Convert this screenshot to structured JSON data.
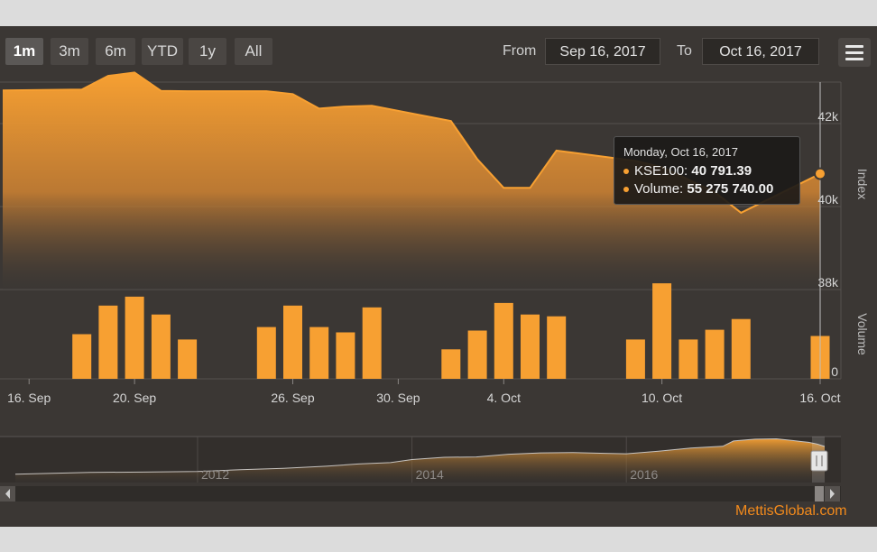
{
  "range_selector": {
    "buttons": [
      "1m",
      "3m",
      "6m",
      "YTD",
      "1y",
      "All"
    ],
    "selected": "1m"
  },
  "date_inputs": {
    "from_label": "From",
    "from_value": "Sep 16, 2017",
    "to_label": "To",
    "to_value": "Oct 16, 2017"
  },
  "menu_icon": "hamburger-menu-icon",
  "tooltip": {
    "header": "Monday, Oct 16, 2017",
    "line1_label": "KSE100:",
    "line1_value": "40 791.39",
    "line2_label": "Volume:",
    "line2_value": "55 275 740.00"
  },
  "credit": "MettisGlobal.com",
  "colors": {
    "accent": "#f7a032",
    "background": "#3b3734",
    "credit": "#f28a1c"
  },
  "chart_data": {
    "type": "area",
    "panels": [
      {
        "name": "price",
        "series_type": "area",
        "axis_title": "Index",
        "ylim": [
          38000,
          43000
        ],
        "yticks": [
          38000,
          40000,
          42000
        ],
        "ytick_labels": [
          "38k",
          "40k",
          "42k"
        ],
        "x": [
          "2017-09-15",
          "2017-09-18",
          "2017-09-19",
          "2017-09-20",
          "2017-09-21",
          "2017-09-22",
          "2017-09-25",
          "2017-09-26",
          "2017-09-27",
          "2017-09-28",
          "2017-09-29",
          "2017-10-02",
          "2017-10-03",
          "2017-10-04",
          "2017-10-05",
          "2017-10-06",
          "2017-10-09",
          "2017-10-10",
          "2017-10-11",
          "2017-10-12",
          "2017-10-13",
          "2017-10-16"
        ],
        "values": [
          42800,
          42820,
          43150,
          43230,
          42790,
          42780,
          42780,
          42710,
          42360,
          42410,
          42430,
          42060,
          41140,
          40450,
          40450,
          41350,
          41100,
          40950,
          40650,
          40350,
          39850,
          40791.39
        ]
      },
      {
        "name": "volume",
        "series_type": "column",
        "axis_title": "Volume",
        "ylim": [
          0,
          100000000
        ],
        "yticks": [
          0
        ],
        "ytick_labels": [
          "0"
        ],
        "x": [
          "2017-09-18",
          "2017-09-19",
          "2017-09-20",
          "2017-09-21",
          "2017-09-22",
          "2017-09-25",
          "2017-09-26",
          "2017-09-27",
          "2017-09-28",
          "2017-09-29",
          "2017-10-02",
          "2017-10-03",
          "2017-10-04",
          "2017-10-05",
          "2017-10-06",
          "2017-10-09",
          "2017-10-10",
          "2017-10-11",
          "2017-10-12",
          "2017-10-13",
          "2017-10-16"
        ],
        "values": [
          50000000,
          82000000,
          92000000,
          72000000,
          44000000,
          58000000,
          82000000,
          58000000,
          52000000,
          80000000,
          33000000,
          54000000,
          85000000,
          72000000,
          70000000,
          44000000,
          107000000,
          44000000,
          55000000,
          67000000,
          48000000
        ]
      }
    ],
    "xticks": [
      "2017-09-16",
      "2017-09-20",
      "2017-09-26",
      "2017-09-30",
      "2017-10-04",
      "2017-10-10",
      "2017-10-16"
    ],
    "xtick_labels": [
      "16. Sep",
      "20. Sep",
      "26. Sep",
      "30. Sep",
      "4. Oct",
      "10. Oct",
      "16. Oct"
    ],
    "xlim": [
      "2017-09-15",
      "2017-10-16"
    ],
    "grid": true,
    "navigator": {
      "tick_labels": [
        "2012",
        "2014",
        "2016"
      ],
      "ticks": [
        2012,
        2014,
        2016
      ],
      "xlim": [
        2010.3,
        2017.85
      ],
      "selected_range": [
        "2017-09-16",
        "2017-10-16"
      ],
      "x": [
        2010.3,
        2011.0,
        2011.5,
        2012.0,
        2012.4,
        2012.8,
        2013.2,
        2013.5,
        2013.8,
        2014.0,
        2014.3,
        2014.6,
        2014.9,
        2015.2,
        2015.5,
        2015.8,
        2016.0,
        2016.3,
        2016.6,
        2016.9,
        2017.0,
        2017.2,
        2017.4,
        2017.55,
        2017.7,
        2017.78,
        2017.85
      ],
      "values": [
        9500,
        11500,
        11800,
        12500,
        14500,
        16000,
        18500,
        21000,
        22500,
        26000,
        28500,
        29000,
        32000,
        33500,
        34000,
        33000,
        32500,
        35500,
        39000,
        41000,
        47000,
        49000,
        49500,
        47500,
        45500,
        43500,
        40800
      ]
    }
  }
}
